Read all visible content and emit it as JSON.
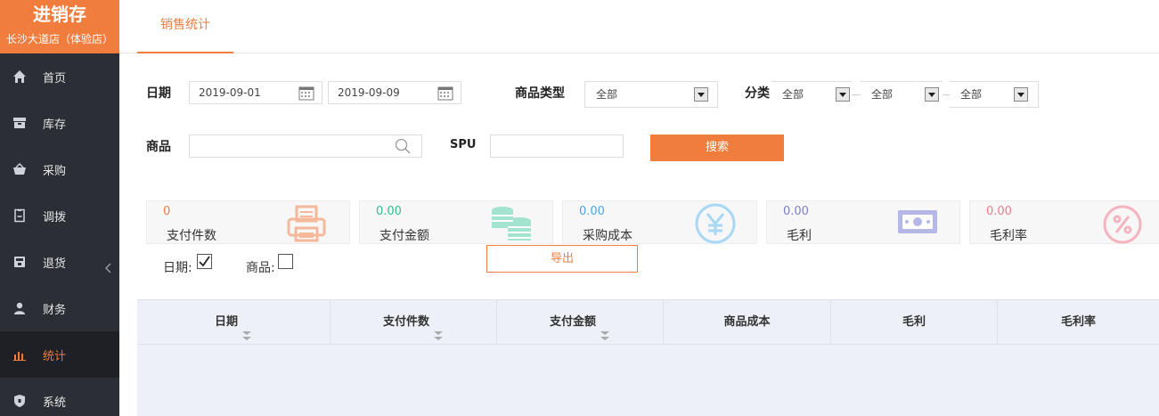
{
  "brand": {
    "title": "进销存",
    "store": "长沙大道店（体验店）"
  },
  "nav": [
    {
      "label": "首页",
      "icon": "home-icon"
    },
    {
      "label": "库存",
      "icon": "inventory-icon"
    },
    {
      "label": "采购",
      "icon": "purchase-basket-icon"
    },
    {
      "label": "调拨",
      "icon": "transfer-doc-icon"
    },
    {
      "label": "退货",
      "icon": "return-box-icon"
    },
    {
      "label": "财务",
      "icon": "user-icon"
    },
    {
      "label": "统计",
      "icon": "bar-chart-icon",
      "active": true
    },
    {
      "label": "系统",
      "icon": "shield-icon"
    }
  ],
  "tabs": [
    {
      "label": "销售统计"
    }
  ],
  "filters": {
    "date_label": "日期",
    "date_start": "2019-09-01",
    "date_end": "2019-09-09",
    "type_label": "商品类型",
    "type_value": "全部",
    "category_label": "分类",
    "category_values": [
      "全部",
      "全部",
      "全部"
    ],
    "product_label": "商品",
    "product_value": "",
    "spu_label": "SPU",
    "spu_value": "",
    "search_label": "搜索"
  },
  "stats": [
    {
      "value": "0",
      "name": "支付件数",
      "color": "#f07c3d",
      "icon": "receipt-printer-icon"
    },
    {
      "value": "0.00",
      "name": "支付金额",
      "color": "#2ebf91",
      "icon": "coin-stack-icon"
    },
    {
      "value": "0.00",
      "name": "采购成本",
      "color": "#4aa8e8",
      "icon": "yen-icon"
    },
    {
      "value": "0.00",
      "name": "毛利",
      "color": "#7b80c9",
      "icon": "banknote-icon"
    },
    {
      "value": "0.00",
      "name": "毛利率",
      "color": "#ef7b8e",
      "icon": "percent-icon"
    }
  ],
  "export": {
    "date_check_label": "日期:",
    "date_checked": true,
    "product_check_label": "商品:",
    "product_checked": false,
    "button_label": "导出"
  },
  "table": {
    "columns": [
      {
        "label": "日期",
        "sortable": true
      },
      {
        "label": "支付件数",
        "sortable": true
      },
      {
        "label": "支付金额",
        "sortable": true
      },
      {
        "label": "商品成本",
        "sortable": false
      },
      {
        "label": "毛利",
        "sortable": false
      },
      {
        "label": "毛利率",
        "sortable": false
      }
    ],
    "rows": []
  }
}
